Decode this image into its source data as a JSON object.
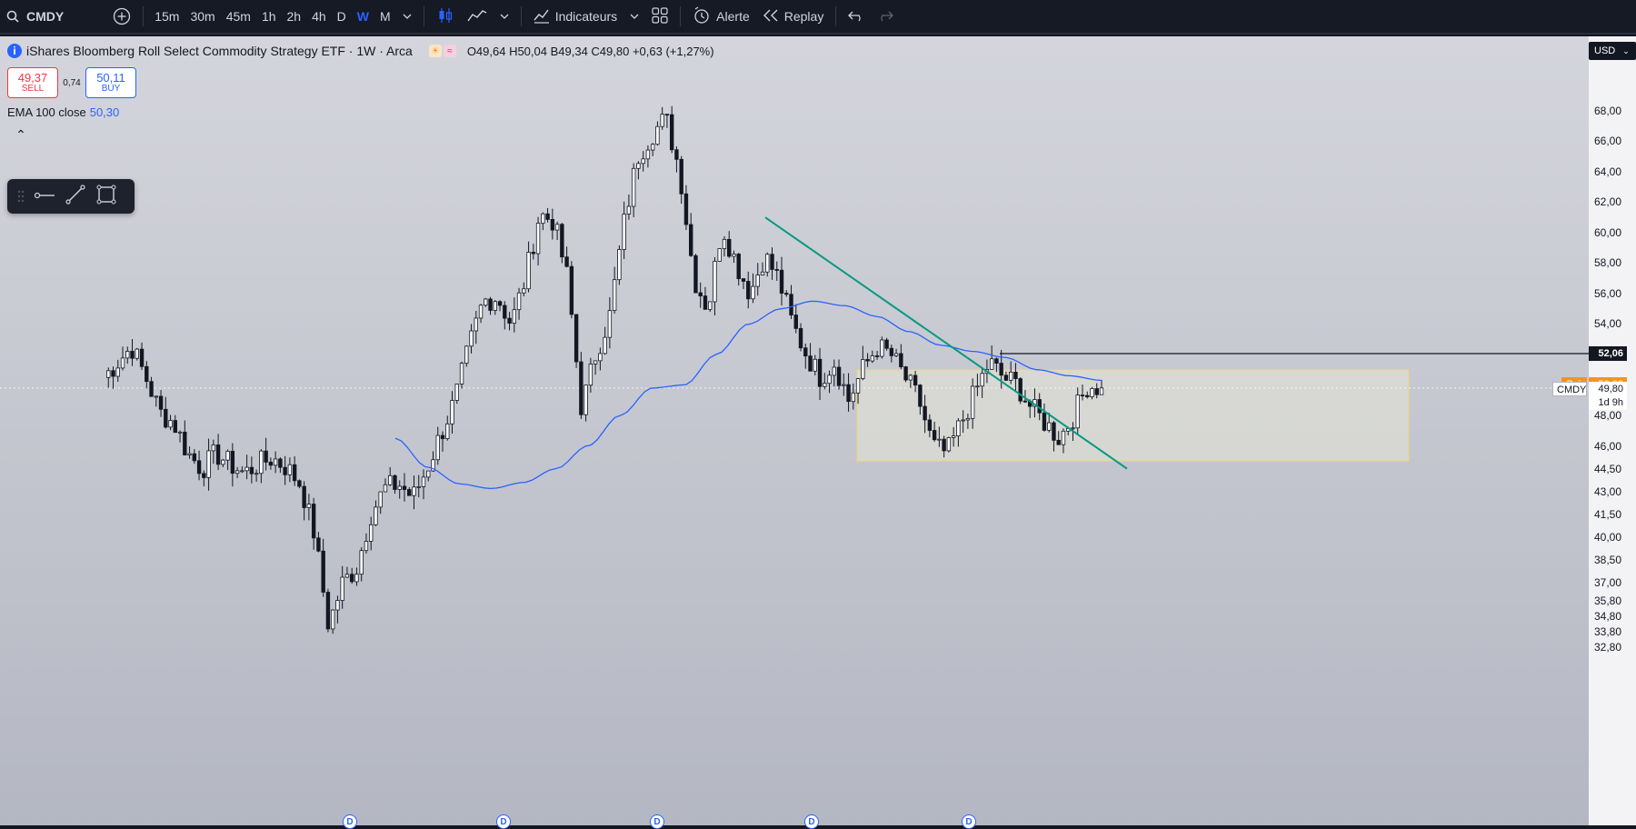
{
  "toolbar": {
    "symbol": "CMDY",
    "timeframes": [
      "15m",
      "30m",
      "45m",
      "1h",
      "2h",
      "4h",
      "D",
      "W",
      "M"
    ],
    "active_timeframe": "W",
    "indicators_label": "Indicateurs",
    "alert_label": "Alerte",
    "replay_label": "Replay"
  },
  "legend": {
    "title": "iShares Bloomberg Roll Select Commodity Strategy ETF · 1W · Arca",
    "ohlc": "O49,64 H50,04 B49,34 C49,80 +0,63 (+1,27%)",
    "sell_price": "49,37",
    "sell_label": "SELL",
    "spread": "0,74",
    "buy_price": "50,11",
    "buy_label": "BUY",
    "ema_label": "EMA 100 close",
    "ema_value": "50,30",
    "collapse_glyph": "⌃"
  },
  "price_axis": {
    "currency": "USD",
    "ticks": [
      "68,00",
      "66,00",
      "64,00",
      "62,00",
      "60,00",
      "58,00",
      "56,00",
      "54,00",
      "52,06",
      "50,00",
      "49,80",
      "48,00",
      "46,00",
      "44,50",
      "43,00",
      "41,50",
      "40,00",
      "38,50",
      "37,00",
      "35,80",
      "34,80",
      "33,80",
      "32,80"
    ],
    "tick_values": [
      68,
      66,
      64,
      62,
      60,
      58,
      56,
      54,
      48,
      46,
      44.5,
      43,
      41.5,
      40,
      38.5,
      37,
      35.8,
      34.8,
      33.8,
      32.8
    ],
    "horizontal_line_value": "52,06",
    "premarket_label": "Pré",
    "premarket_value": "50,00",
    "last_symbol": "CMDY",
    "last_value": "49,80",
    "countdown": "1d 9h"
  },
  "dividend_marker": "D",
  "colors": {
    "candle": "#131722",
    "ema": "#2962ff",
    "trendline": "#089981",
    "hline": "#131722",
    "zone_border": "#f0d46a",
    "premarket": "#f7931a"
  },
  "chart_data": {
    "type": "candlestick",
    "ema_period": 100,
    "trendline": {
      "from": 61.0,
      "to": 44.5
    },
    "horizontal_line": 52.06,
    "zone": {
      "top": 51.0,
      "bottom": 45.0
    },
    "price_waypoints": [
      50.5,
      51.5,
      52.5,
      50.5,
      48.2,
      47.5,
      45.5,
      44.5,
      45.5,
      44.8,
      44.2,
      44.8,
      45.2,
      44.6,
      43.5,
      40.2,
      34.2,
      37.0,
      38.0,
      41.5,
      43.2,
      43.5,
      42.6,
      44.5,
      46.8,
      49.0,
      52.5,
      55.5,
      55.8,
      54.0,
      57.0,
      61.2,
      60.8,
      57.0,
      48.4,
      52.0,
      54.5,
      60.5,
      65.0,
      66.5,
      67.5,
      64.0,
      57.0,
      55.0,
      60.5,
      58.0,
      56.0,
      58.5,
      57.0,
      54.0,
      52.0,
      50.5,
      51.5,
      49.0,
      51.0,
      52.5,
      52.0,
      50.5,
      49.0,
      46.0,
      45.5,
      47.5,
      49.5,
      51.5,
      50.5,
      50.0,
      48.5,
      47.5,
      46.5,
      48.0,
      50.0,
      49.8
    ],
    "ema_waypoints": [
      46.5,
      44.6,
      43.5,
      43.2,
      43.6,
      44.5,
      46.0,
      48.0,
      49.8,
      50.0,
      52.0,
      54.0,
      55.0,
      55.5,
      55.2,
      54.5,
      53.5,
      52.6,
      52.2,
      51.8,
      51.0,
      50.6,
      50.3
    ]
  }
}
